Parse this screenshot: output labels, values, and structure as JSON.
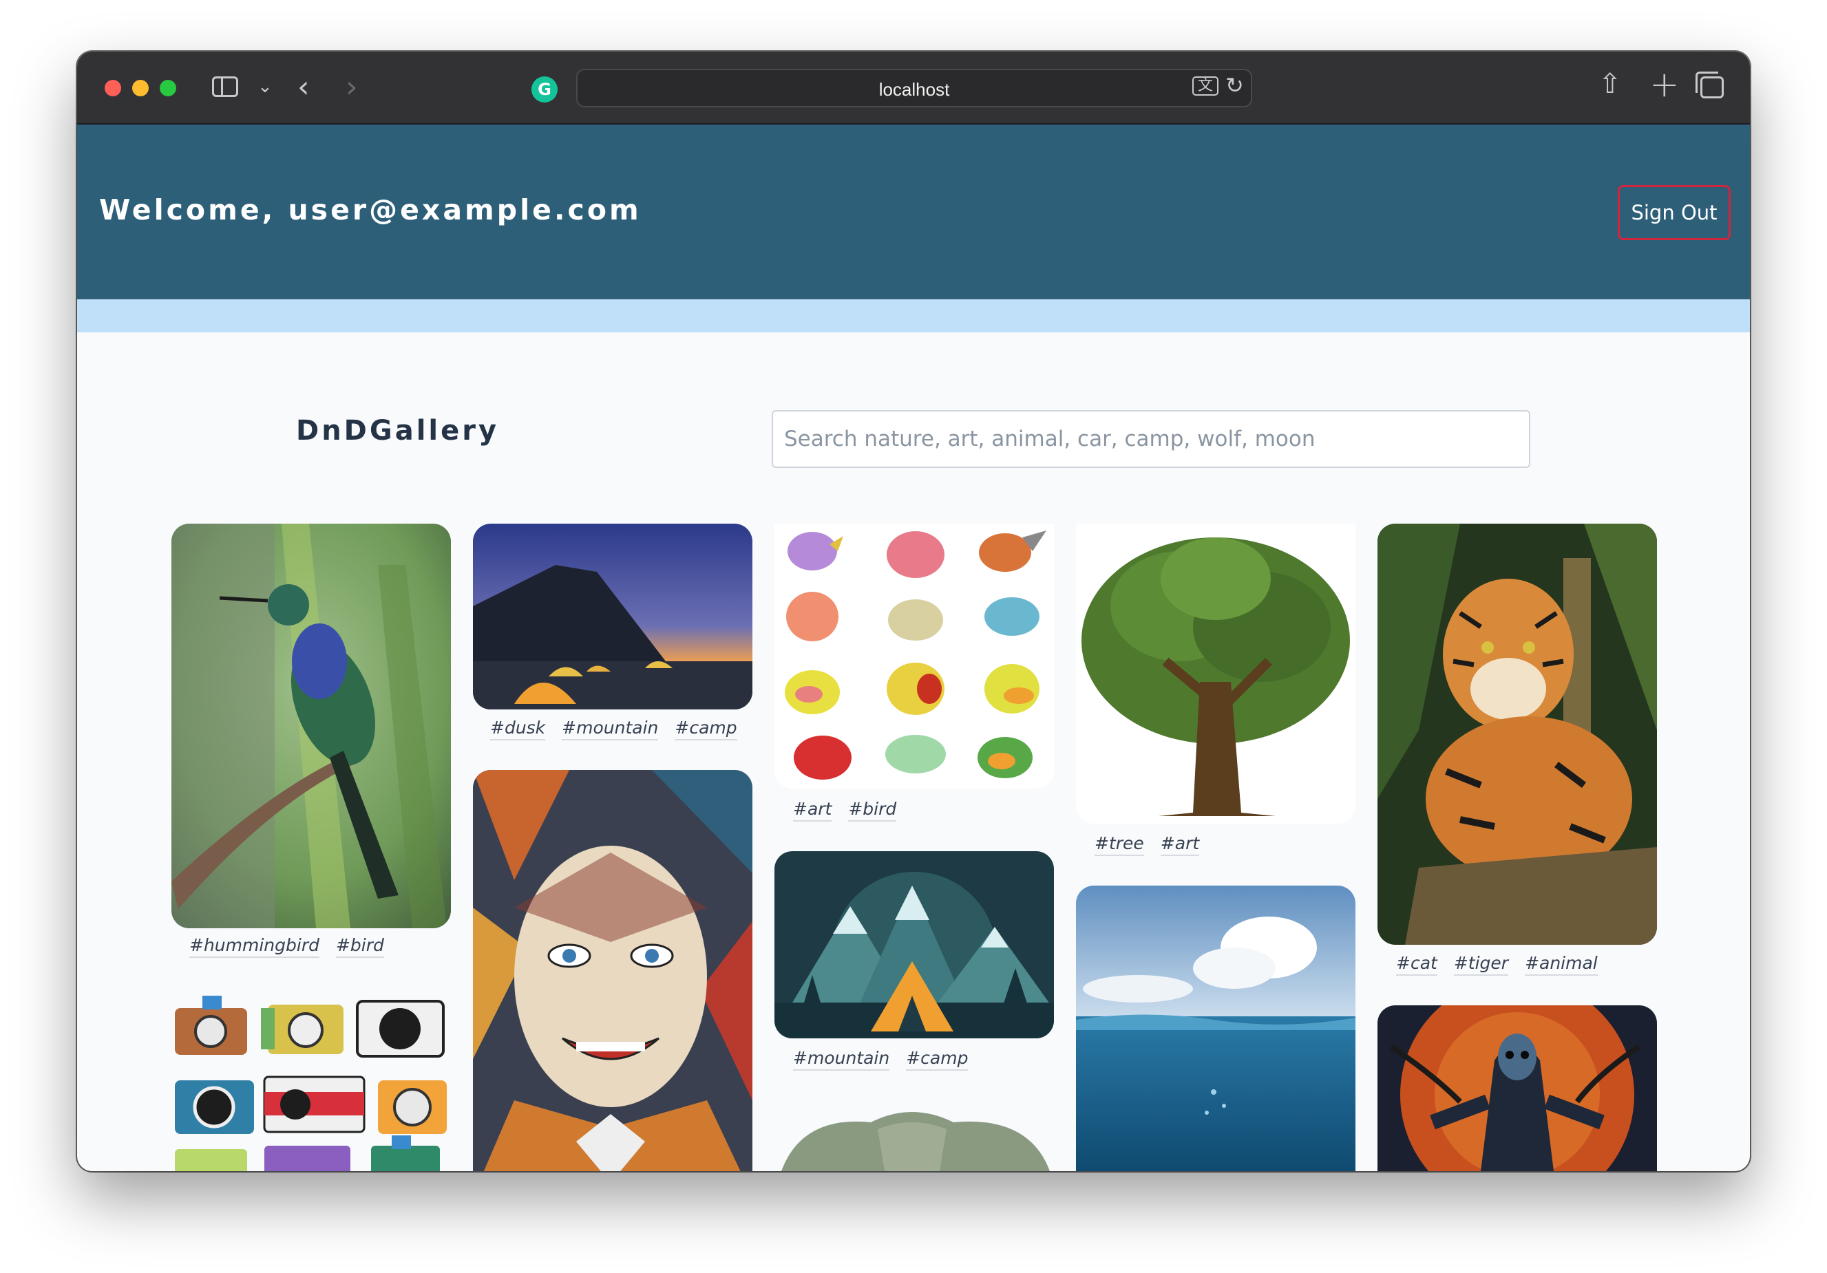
{
  "browser": {
    "url": "localhost",
    "icons": [
      "sidebar-icon",
      "chevron-down-icon",
      "back-icon",
      "forward-icon",
      "grammarly-icon",
      "translate-icon",
      "reload-icon",
      "share-icon",
      "new-tab-icon",
      "tab-overview-icon"
    ]
  },
  "header": {
    "welcome": "Welcome, user@example.com",
    "signout_label": "Sign Out",
    "bg_color": "#2d5f78",
    "accent_border": "#d0263f"
  },
  "main": {
    "brand": "DnDGallery",
    "search_placeholder": "Search nature, art, animal, car, camp, wolf, moon",
    "search_value": ""
  },
  "gallery": [
    {
      "subject": "hummingbird",
      "tags": [
        "#hummingbird",
        "#bird"
      ]
    },
    {
      "subject": "cameras",
      "tags": []
    },
    {
      "subject": "dusk mountain camp",
      "tags": [
        "#dusk",
        "#mountain",
        "#camp"
      ]
    },
    {
      "subject": "cubist face",
      "tags": []
    },
    {
      "subject": "cartoon birds",
      "tags": [
        "#art",
        "#bird"
      ]
    },
    {
      "subject": "tent illustration",
      "tags": [
        "#mountain",
        "#camp"
      ]
    },
    {
      "subject": "elephant",
      "tags": []
    },
    {
      "subject": "tree",
      "tags": [
        "#tree",
        "#art"
      ]
    },
    {
      "subject": "ocean",
      "tags": []
    },
    {
      "subject": "tiger",
      "tags": [
        "#cat",
        "#tiger",
        "#animal"
      ]
    },
    {
      "subject": "grim reaper",
      "tags": []
    }
  ]
}
